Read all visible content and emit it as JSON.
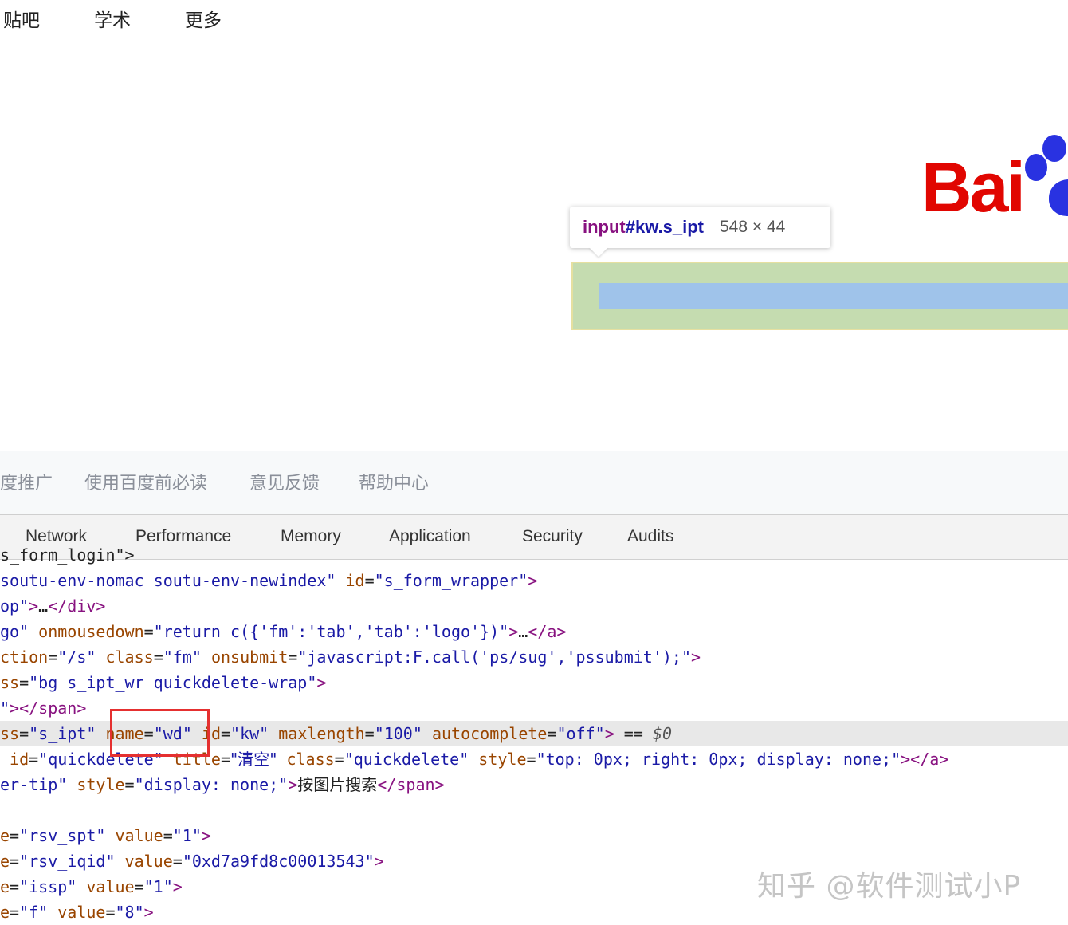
{
  "page": {
    "topnav": [
      "贴吧",
      "学术",
      "更多"
    ],
    "logo_text": "Bai",
    "tooltip": {
      "tag": "input",
      "selector": "#kw.s_ipt",
      "size": "548 × 44"
    },
    "footer_links": [
      "度推广",
      "使用百度前必读",
      "意见反馈",
      "帮助中心"
    ]
  },
  "devtools": {
    "tabs": [
      "Network",
      "Performance",
      "Memory",
      "Application",
      "Security",
      "Audits"
    ],
    "lines": [
      [
        {
          "t": "tx",
          "v": "s_form_login\">"
        }
      ],
      [
        {
          "t": "av",
          "v": "soutu-env-nomac soutu-env-newindex\""
        },
        {
          "t": "an",
          "v": " id"
        },
        {
          "t": "tx",
          "v": "="
        },
        {
          "t": "av",
          "v": "\"s_form_wrapper\""
        },
        {
          "t": "tg",
          "v": ">"
        }
      ],
      [
        {
          "t": "av",
          "v": "op\""
        },
        {
          "t": "tg",
          "v": ">"
        },
        {
          "t": "tx",
          "v": "…"
        },
        {
          "t": "tg",
          "v": "</div>"
        }
      ],
      [
        {
          "t": "av",
          "v": "go\""
        },
        {
          "t": "an",
          "v": " onmousedown"
        },
        {
          "t": "tx",
          "v": "="
        },
        {
          "t": "av",
          "v": "\"return c({'fm':'tab','tab':'logo'})\""
        },
        {
          "t": "tg",
          "v": ">"
        },
        {
          "t": "tx",
          "v": "…"
        },
        {
          "t": "tg",
          "v": "</a>"
        }
      ],
      [
        {
          "t": "an",
          "v": "ction"
        },
        {
          "t": "tx",
          "v": "="
        },
        {
          "t": "av",
          "v": "\"/s\""
        },
        {
          "t": "an",
          "v": " class"
        },
        {
          "t": "tx",
          "v": "="
        },
        {
          "t": "av",
          "v": "\"fm\""
        },
        {
          "t": "an",
          "v": " onsubmit"
        },
        {
          "t": "tx",
          "v": "="
        },
        {
          "t": "av",
          "v": "\"javascript:F.call('ps/sug','pssubmit');\""
        },
        {
          "t": "tg",
          "v": ">"
        }
      ],
      [
        {
          "t": "an",
          "v": "ss"
        },
        {
          "t": "tx",
          "v": "="
        },
        {
          "t": "av",
          "v": "\"bg s_ipt_wr quickdelete-wrap\""
        },
        {
          "t": "tg",
          "v": ">"
        }
      ],
      [
        {
          "t": "av",
          "v": "\""
        },
        {
          "t": "tg",
          "v": "></span>"
        }
      ],
      [
        {
          "t": "an",
          "v": "ss"
        },
        {
          "t": "tx",
          "v": "="
        },
        {
          "t": "av",
          "v": "\"s_ipt\""
        },
        {
          "t": "an",
          "v": " name"
        },
        {
          "t": "tx",
          "v": "="
        },
        {
          "t": "av",
          "v": "\"wd\""
        },
        {
          "t": "an",
          "v": " id"
        },
        {
          "t": "tx",
          "v": "="
        },
        {
          "t": "av",
          "v": "\"kw\""
        },
        {
          "t": "an",
          "v": " maxlength"
        },
        {
          "t": "tx",
          "v": "="
        },
        {
          "t": "av",
          "v": "\"100\""
        },
        {
          "t": "an",
          "v": " autocomplete"
        },
        {
          "t": "tx",
          "v": "="
        },
        {
          "t": "av",
          "v": "\"off\""
        },
        {
          "t": "tg",
          "v": ">"
        },
        {
          "t": "tx",
          "v": " == "
        },
        {
          "t": "dm",
          "v": "$0"
        }
      ],
      [
        {
          "t": "an",
          "v": " id"
        },
        {
          "t": "tx",
          "v": "="
        },
        {
          "t": "av",
          "v": "\"quickdelete\""
        },
        {
          "t": "an",
          "v": " title"
        },
        {
          "t": "tx",
          "v": "="
        },
        {
          "t": "av",
          "v": "\"清空\""
        },
        {
          "t": "an",
          "v": " class"
        },
        {
          "t": "tx",
          "v": "="
        },
        {
          "t": "av",
          "v": "\"quickdelete\""
        },
        {
          "t": "an",
          "v": " style"
        },
        {
          "t": "tx",
          "v": "="
        },
        {
          "t": "av",
          "v": "\"top: 0px; right: 0px; display: none;\""
        },
        {
          "t": "tg",
          "v": "></a>"
        }
      ],
      [
        {
          "t": "av",
          "v": "er-tip\""
        },
        {
          "t": "an",
          "v": " style"
        },
        {
          "t": "tx",
          "v": "="
        },
        {
          "t": "av",
          "v": "\"display: none;\""
        },
        {
          "t": "tg",
          "v": ">"
        },
        {
          "t": "tx",
          "v": "按图片搜索"
        },
        {
          "t": "tg",
          "v": "</span>"
        }
      ],
      [],
      [
        {
          "t": "an",
          "v": "e"
        },
        {
          "t": "tx",
          "v": "="
        },
        {
          "t": "av",
          "v": "\"rsv_spt\""
        },
        {
          "t": "an",
          "v": " value"
        },
        {
          "t": "tx",
          "v": "="
        },
        {
          "t": "av",
          "v": "\"1\""
        },
        {
          "t": "tg",
          "v": ">"
        }
      ],
      [
        {
          "t": "an",
          "v": "e"
        },
        {
          "t": "tx",
          "v": "="
        },
        {
          "t": "av",
          "v": "\"rsv_iqid\""
        },
        {
          "t": "an",
          "v": " value"
        },
        {
          "t": "tx",
          "v": "="
        },
        {
          "t": "av",
          "v": "\"0xd7a9fd8c00013543\""
        },
        {
          "t": "tg",
          "v": ">"
        }
      ],
      [
        {
          "t": "an",
          "v": "e"
        },
        {
          "t": "tx",
          "v": "="
        },
        {
          "t": "av",
          "v": "\"issp\""
        },
        {
          "t": "an",
          "v": " value"
        },
        {
          "t": "tx",
          "v": "="
        },
        {
          "t": "av",
          "v": "\"1\""
        },
        {
          "t": "tg",
          "v": ">"
        }
      ],
      [
        {
          "t": "an",
          "v": "e"
        },
        {
          "t": "tx",
          "v": "="
        },
        {
          "t": "av",
          "v": "\"f\""
        },
        {
          "t": "an",
          "v": " value"
        },
        {
          "t": "tx",
          "v": "="
        },
        {
          "t": "av",
          "v": "\"8\""
        },
        {
          "t": "tg",
          "v": ">"
        }
      ]
    ],
    "selected_line": 7
  },
  "watermark": "知乎 @软件测试小P",
  "colors": {
    "attr_name": "#994500",
    "attr_value": "#1a1aa6",
    "tag": "#881280",
    "highlight_margin": "#c5dcb0",
    "highlight_content": "#9fc3ea",
    "annotation_box": "#e53030",
    "baidu_red": "#e10601",
    "baidu_blue": "#2932e1"
  }
}
